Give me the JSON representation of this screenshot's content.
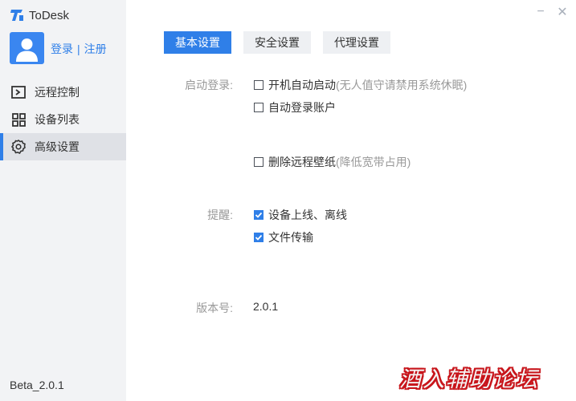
{
  "app": {
    "title": "ToDesk",
    "version": "Beta_2.0.1"
  },
  "account": {
    "login": "登录",
    "separator": "|",
    "register": "注册"
  },
  "sidebar": {
    "items": [
      {
        "label": "远程控制",
        "icon": "remote-control-icon",
        "active": false
      },
      {
        "label": "设备列表",
        "icon": "device-list-icon",
        "active": false
      },
      {
        "label": "高级设置",
        "icon": "gear-icon",
        "active": true
      }
    ]
  },
  "window_controls": {
    "minimize": "−",
    "close": "✕"
  },
  "tabs": [
    {
      "label": "基本设置",
      "active": true
    },
    {
      "label": "安全设置",
      "active": false
    },
    {
      "label": "代理设置",
      "active": false
    }
  ],
  "settings": {
    "startup": {
      "label": "启动登录:",
      "options": [
        {
          "text": "开机自动启动",
          "hint": "(无人值守请禁用系统休眠)",
          "checked": false
        },
        {
          "text": "自动登录账户",
          "hint": "",
          "checked": false
        }
      ]
    },
    "wallpaper": {
      "text": "删除远程壁纸",
      "hint": "(降低宽带占用)",
      "checked": false
    },
    "remind": {
      "label": "提醒:",
      "options": [
        {
          "text": "设备上线、离线",
          "checked": true
        },
        {
          "text": "文件传输",
          "checked": true
        }
      ]
    },
    "version": {
      "label": "版本号:",
      "value": "2.0.1"
    }
  },
  "watermark": {
    "text": "酒入辅助论坛"
  },
  "colors": {
    "accent": "#2f7fe8",
    "sidebar_bg": "#f2f3f5",
    "watermark_red": "#c8151b"
  }
}
